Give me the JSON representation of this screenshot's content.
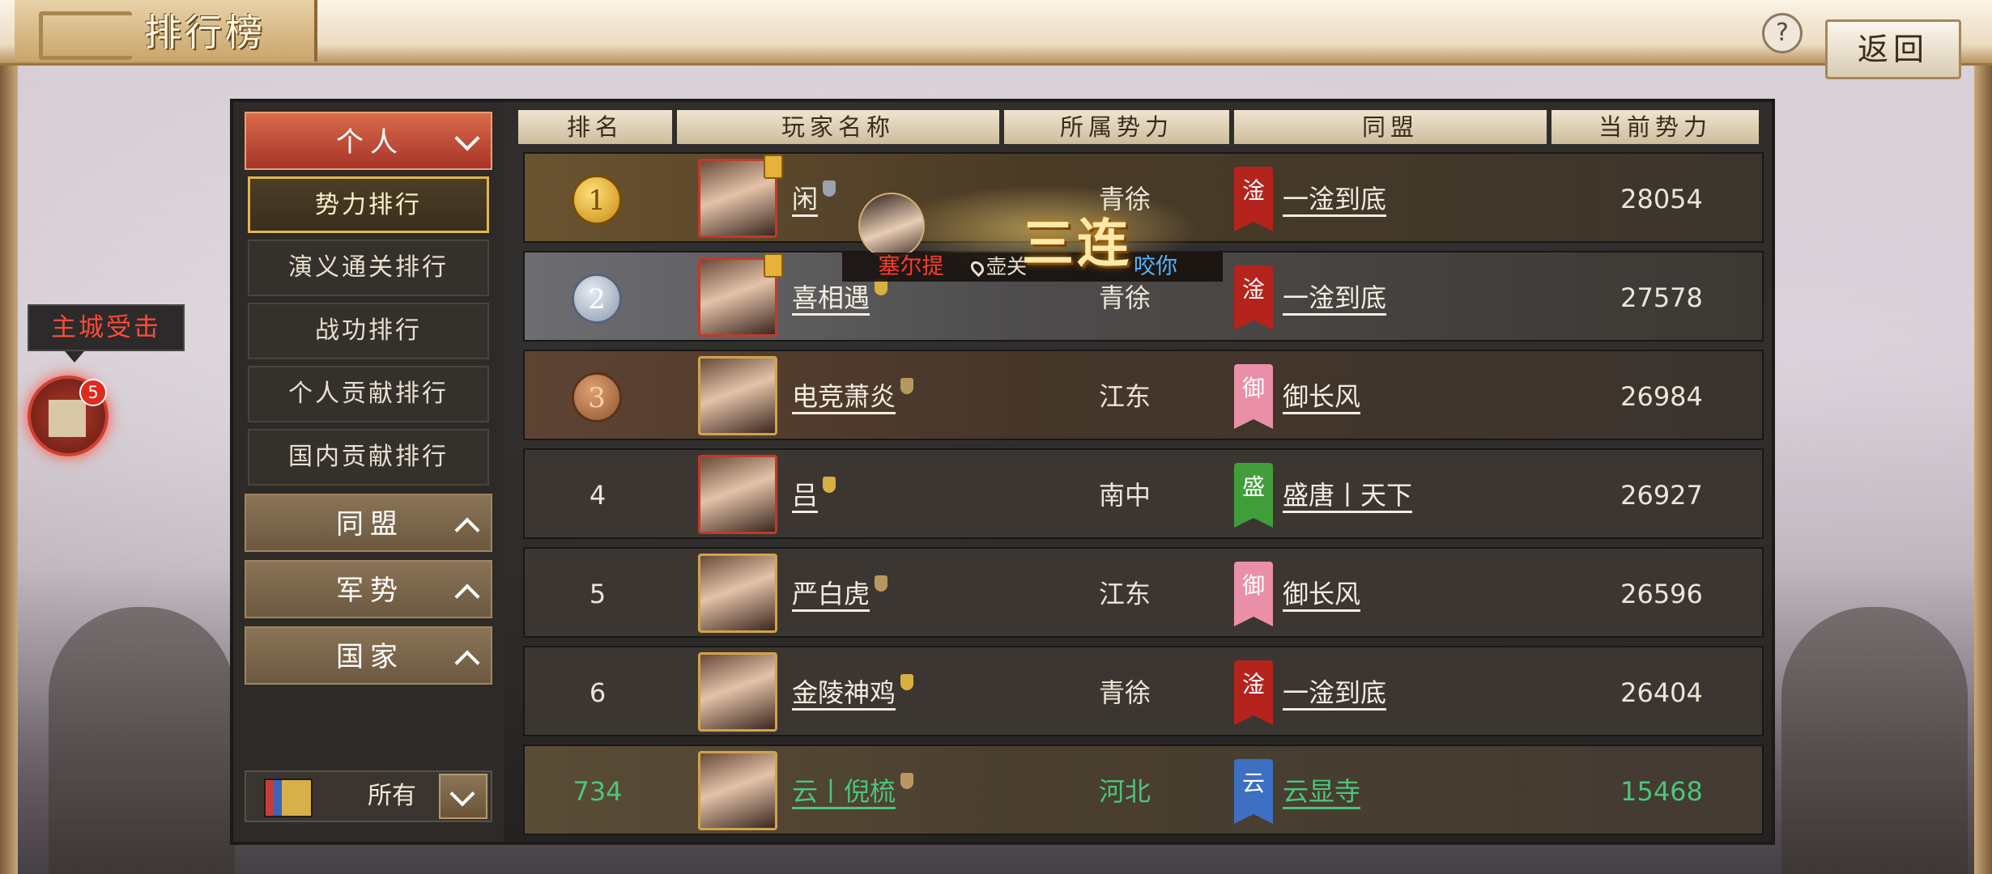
{
  "header": {
    "title": "排行榜",
    "help": "?",
    "back": "返回"
  },
  "sidebar": {
    "personal": {
      "label": "个人",
      "items": [
        {
          "label": "势力排行",
          "selected": true
        },
        {
          "label": "演义通关排行",
          "selected": false
        },
        {
          "label": "战功排行",
          "selected": false
        },
        {
          "label": "个人贡献排行",
          "selected": false
        },
        {
          "label": "国内贡献排行",
          "selected": false
        }
      ]
    },
    "alliance": {
      "label": "同盟"
    },
    "army": {
      "label": "军势"
    },
    "country": {
      "label": "国家"
    },
    "filter": {
      "label": "所有"
    }
  },
  "table": {
    "columns": [
      "排名",
      "玩家名称",
      "所属势力",
      "同盟",
      "当前势力"
    ],
    "rows": [
      {
        "rank": "1",
        "medal": "gold",
        "name": "闲",
        "faction": "青徐",
        "alliance_icon": "淦",
        "alliance_color": "#b5231d",
        "alliance": "一淦到底",
        "power": "28054"
      },
      {
        "rank": "2",
        "medal": "silver",
        "name": "喜相遇",
        "faction": "青徐",
        "alliance_icon": "淦",
        "alliance_color": "#b5231d",
        "alliance": "一淦到底",
        "power": "27578"
      },
      {
        "rank": "3",
        "medal": "bronze",
        "name": "电竞萧炎",
        "faction": "江东",
        "alliance_icon": "御",
        "alliance_color": "#e990a8",
        "alliance": "御长风",
        "power": "26984"
      },
      {
        "rank": "4",
        "name": "吕",
        "faction": "南中",
        "alliance_icon": "盛",
        "alliance_color": "#3f9e3a",
        "alliance": "盛唐丨天下",
        "power": "26927"
      },
      {
        "rank": "5",
        "name": "严白虎",
        "faction": "江东",
        "alliance_icon": "御",
        "alliance_color": "#e990a8",
        "alliance": "御长风",
        "power": "26596"
      },
      {
        "rank": "6",
        "name": "金陵神鸡",
        "faction": "青徐",
        "alliance_icon": "淦",
        "alliance_color": "#b5231d",
        "alliance": "一淦到底",
        "power": "26404"
      }
    ],
    "self": {
      "rank": "734",
      "name": "云丨倪梳",
      "faction": "河北",
      "alliance_icon": "云",
      "alliance_color": "#3d6fc2",
      "alliance": "云显寺",
      "power": "15468"
    }
  },
  "combo": {
    "title": "三连",
    "player": "塞尔提",
    "location": "壶关",
    "action": "咬你"
  },
  "alert": {
    "label": "主城受击",
    "count": "5"
  }
}
